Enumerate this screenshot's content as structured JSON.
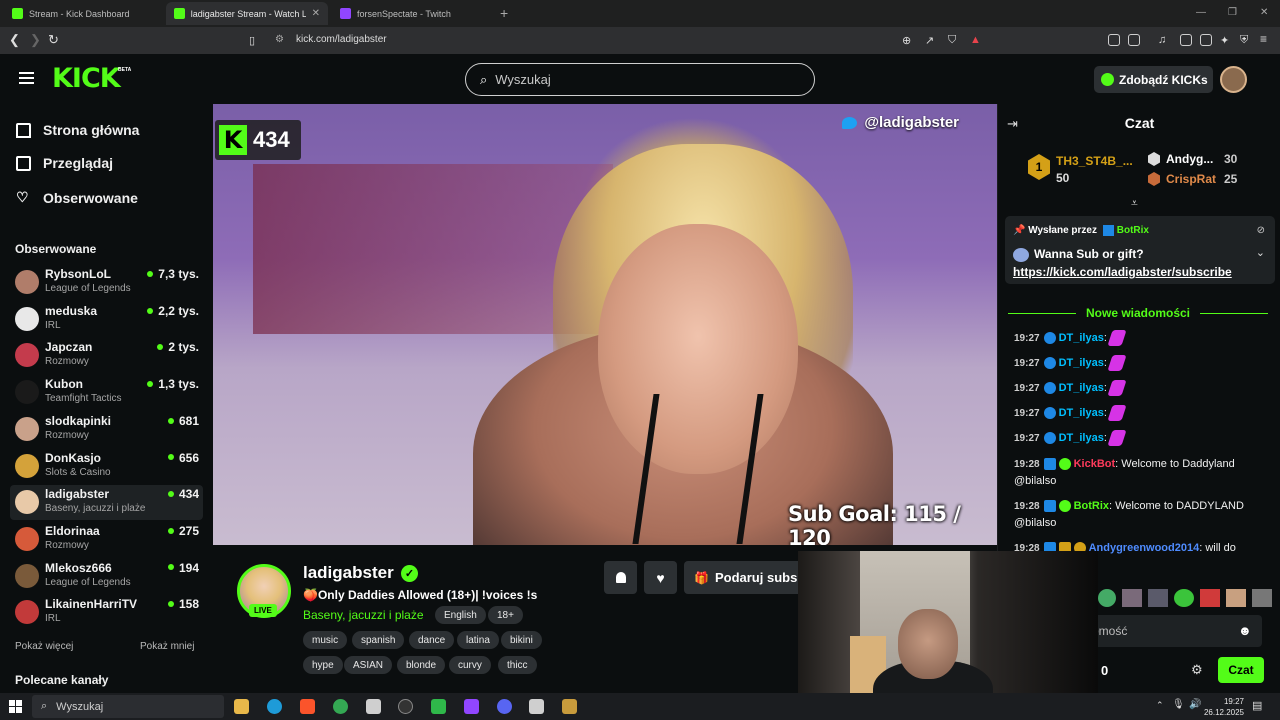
{
  "browser": {
    "tabs": [
      {
        "label": "Stream - Kick Dashboard",
        "color": "#53fc18"
      },
      {
        "label": "ladigabster Stream - Watch Li",
        "color": "#53fc18"
      },
      {
        "label": "forsenSpectate - Twitch",
        "color": "#9146ff"
      }
    ],
    "url": "kick.com/ladigabster"
  },
  "header": {
    "logo": "KICK",
    "beta": "BETA",
    "search_placeholder": "Wyszukaj",
    "get_kicks": "Zdobądź KICKs"
  },
  "sidebar": {
    "nav": [
      {
        "label": "Strona główna",
        "icon": "home-icon"
      },
      {
        "label": "Przeglądaj",
        "icon": "browse-icon"
      },
      {
        "label": "Obserwowane",
        "icon": "heart-icon"
      }
    ],
    "followed_title": "Obserwowane",
    "channels": [
      {
        "name": "RybsonLoL",
        "category": "League of Legends",
        "viewers": "7,3 tys.",
        "color": "#b07d6a"
      },
      {
        "name": "meduska",
        "category": "IRL",
        "viewers": "2,2 tys.",
        "color": "#e8e8e8"
      },
      {
        "name": "Japczan",
        "category": "Rozmowy",
        "viewers": "2 tys.",
        "color": "#c43b4c"
      },
      {
        "name": "Kubon",
        "category": "Teamfight Tactics",
        "viewers": "1,3 tys.",
        "color": "#1a1a1a"
      },
      {
        "name": "slodkapinki",
        "category": "Rozmowy",
        "viewers": "681",
        "color": "#c9a18a"
      },
      {
        "name": "DonKasjo",
        "category": "Slots & Casino",
        "viewers": "656",
        "color": "#d4a23a"
      },
      {
        "name": "ladigabster",
        "category": "Baseny, jacuzzi i plaże",
        "viewers": "434",
        "color": "#e8c9a8"
      },
      {
        "name": "Eldorinaa",
        "category": "Rozmowy",
        "viewers": "275",
        "color": "#d65a3a"
      },
      {
        "name": "Mlekosz666",
        "category": "League of Legends",
        "viewers": "194",
        "color": "#7a5a3a"
      },
      {
        "name": "LikainenHarriTV",
        "category": "IRL",
        "viewers": "158",
        "color": "#c23a3a"
      }
    ],
    "show_more": "Pokaż więcej",
    "show_less": "Pokaż mniej",
    "recommended_title": "Polecane kanały"
  },
  "video": {
    "viewer_count": "434",
    "twitter_handle": "@ladigabster",
    "sub_goal": "Sub Goal:  115 / 120"
  },
  "stream": {
    "name": "ladigabster",
    "live_label": "LIVE",
    "title": "🍑Only Daddies Allowed (18+)| !voices !s",
    "category": "Baseny, jacuzzi i plaże",
    "badges": [
      "English",
      "18+"
    ],
    "tags_row1": [
      "music",
      "spanish",
      "dance",
      "latina",
      "bikini"
    ],
    "tags_row2": [
      "hype",
      "ASIAN",
      "blonde",
      "curvy",
      "thicc"
    ],
    "gift_sub_label": "Podaruj subs"
  },
  "chat": {
    "title": "Czat",
    "leaderboard": {
      "first_name": "TH3_ST4B_...",
      "first_value": "50",
      "second_name": "Andyg...",
      "second_value": "30",
      "third_name": "CrispRat",
      "third_value": "25"
    },
    "pinned": {
      "header_prefix": "Wysłane przez",
      "header_user": "BotRix",
      "message": "Wanna Sub or gift?",
      "link": "https://kick.com/ladigabster/subscribe"
    },
    "new_messages": "Nowe wiadomości",
    "messages": [
      {
        "time": "19:27",
        "user": "DT_ilyas",
        "color": "#00bfff",
        "text": ""
      },
      {
        "time": "19:27",
        "user": "DT_ilyas",
        "color": "#00bfff",
        "text": ""
      },
      {
        "time": "19:27",
        "user": "DT_ilyas",
        "color": "#00bfff",
        "text": ""
      },
      {
        "time": "19:27",
        "user": "DT_ilyas",
        "color": "#00bfff",
        "text": ""
      },
      {
        "time": "19:27",
        "user": "DT_ilyas",
        "color": "#00bfff",
        "text": ""
      },
      {
        "time": "19:28",
        "user": "KickBot",
        "color": "#ff3b5c",
        "text": " Welcome to Daddyland @bilalso"
      },
      {
        "time": "19:28",
        "user": "BotRix",
        "color": "#53fc18",
        "text": " Welcome to DADDYLAND @bilalso"
      },
      {
        "time": "19:28",
        "user": "Andygreenwood2014",
        "color": "#4f8cff",
        "text": " will do"
      }
    ],
    "input_placeholder": "omość",
    "points": "0",
    "send_label": "Czat"
  },
  "taskbar": {
    "search_placeholder": "Wyszukaj",
    "time": "19:27",
    "date": "26.12.2025"
  }
}
